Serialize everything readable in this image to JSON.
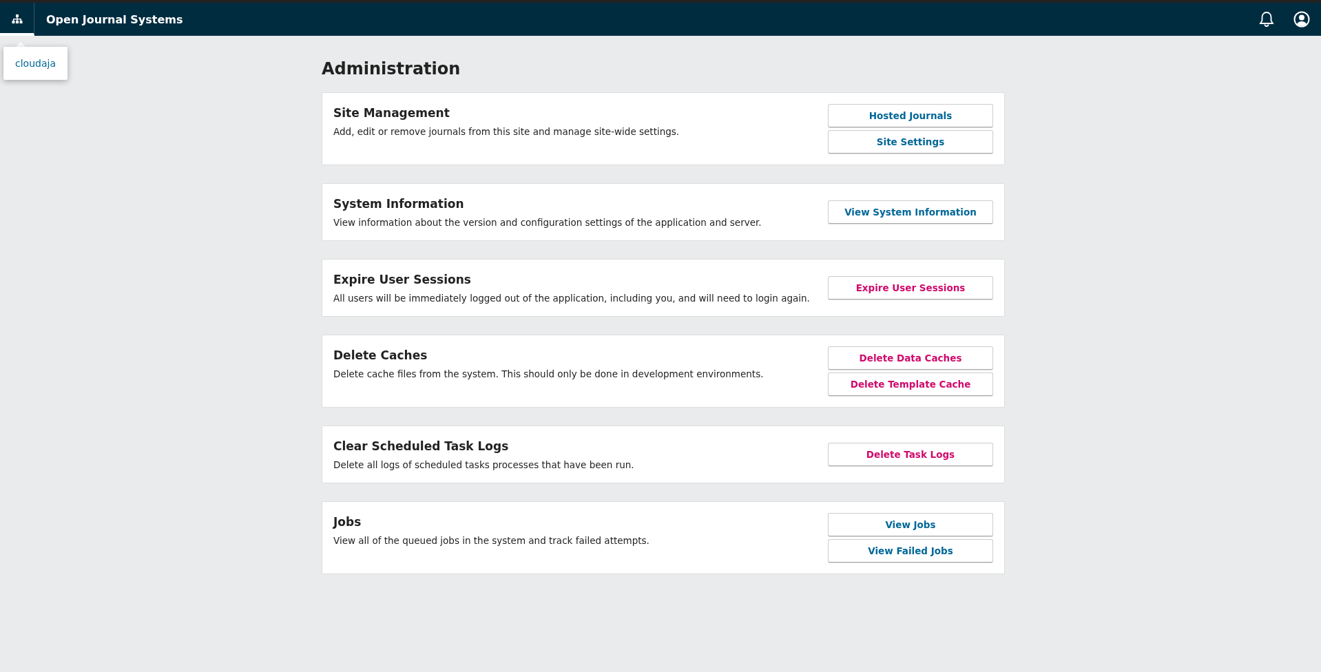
{
  "header": {
    "title": "Open Journal Systems",
    "context_tooltip": "cloudaja"
  },
  "page_title": "Administration",
  "sections": [
    {
      "title": "Site Management",
      "description": "Add, edit or remove journals from this site and manage site-wide settings.",
      "buttons": [
        {
          "label": "Hosted Journals",
          "kind": "default"
        },
        {
          "label": "Site Settings",
          "kind": "default"
        }
      ]
    },
    {
      "title": "System Information",
      "description": "View information about the version and configuration settings of the application and server.",
      "buttons": [
        {
          "label": "View System Information",
          "kind": "default"
        }
      ]
    },
    {
      "title": "Expire User Sessions",
      "description": "All users will be immediately logged out of the application, including you, and will need to login again.",
      "buttons": [
        {
          "label": "Expire User Sessions",
          "kind": "danger"
        }
      ]
    },
    {
      "title": "Delete Caches",
      "description": "Delete cache files from the system. This should only be done in development environments.",
      "buttons": [
        {
          "label": "Delete Data Caches",
          "kind": "danger"
        },
        {
          "label": "Delete Template Cache",
          "kind": "danger"
        }
      ]
    },
    {
      "title": "Clear Scheduled Task Logs",
      "description": "Delete all logs of scheduled tasks processes that have been run.",
      "buttons": [
        {
          "label": "Delete Task Logs",
          "kind": "danger"
        }
      ]
    },
    {
      "title": "Jobs",
      "description": "View all of the queued jobs in the system and track failed attempts.",
      "buttons": [
        {
          "label": "View Jobs",
          "kind": "default"
        },
        {
          "label": "View Failed Jobs",
          "kind": "default"
        }
      ]
    }
  ]
}
